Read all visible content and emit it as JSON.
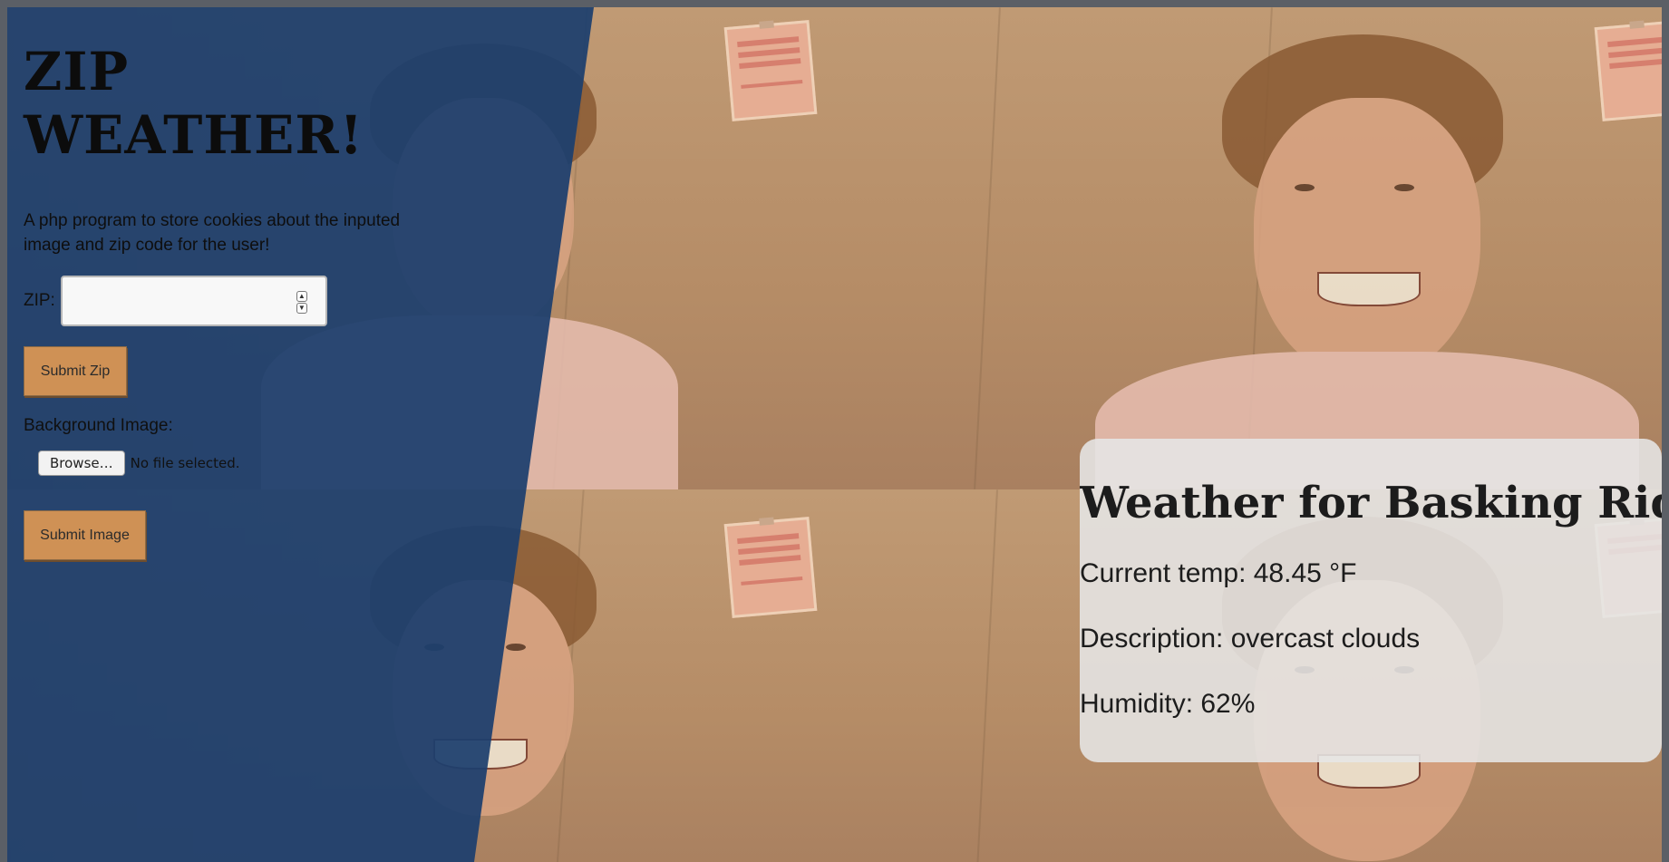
{
  "app": {
    "title": "ZIP WEATHER!",
    "description": "A php program to store cookies about the inputed image and zip code for the user!"
  },
  "zip_form": {
    "label": "ZIP:",
    "value": "",
    "submit_label": "Submit Zip"
  },
  "image_form": {
    "label": "Background Image:",
    "browse_label": "Browse…",
    "file_status": "No file selected.",
    "submit_label": "Submit Image"
  },
  "weather": {
    "title": "Weather for Basking Ridge",
    "current_temp": "Current temp: 48.45 °F",
    "description": "Description: overcast clouds",
    "humidity": "Humidity: 62%"
  },
  "colors": {
    "panel": "#1c3e6e",
    "button": "#cf9155",
    "card": "#e6e6e6"
  }
}
